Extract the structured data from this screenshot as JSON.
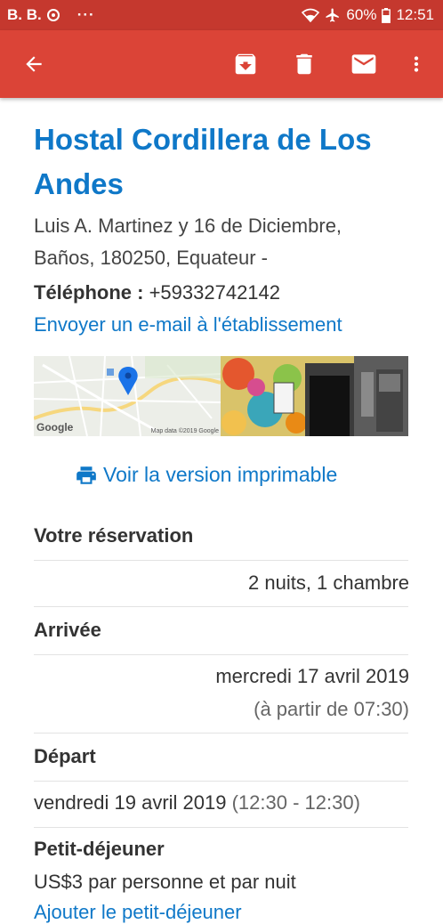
{
  "status_bar": {
    "notification_text": "B. B.",
    "more_dots": "···",
    "battery": "60%",
    "time": "12:51"
  },
  "hotel": {
    "name": "Hostal Cordillera de Los Andes",
    "address_line1": "Luis A. Martinez y 16 de Diciembre,",
    "address_line2": "Baños, 180250, Equateur -",
    "phone_label": "Téléphone :",
    "phone_number": "+59332742142",
    "email_link": "Envoyer un e-mail à l'établissement"
  },
  "map": {
    "logo": "Google",
    "attribution": "Map data ©2019 Google"
  },
  "print_link": "Voir la version imprimable",
  "reservation": {
    "label": "Votre réservation",
    "value": "2 nuits, 1 chambre"
  },
  "arrival": {
    "label": "Arrivée",
    "date": "mercredi 17 avril 2019",
    "time": "(à partir de 07:30)"
  },
  "departure": {
    "label": "Départ",
    "date": "vendredi 19 avril 2019",
    "time": "(12:30 - 12:30)"
  },
  "breakfast": {
    "label": "Petit-déjeuner",
    "price": "US$3 par personne et par nuit",
    "add_link": "Ajouter le petit-déjeuner"
  },
  "colors": {
    "app_bar": "#db4437",
    "status_bar": "#c5382e",
    "link": "#0f78c8"
  }
}
